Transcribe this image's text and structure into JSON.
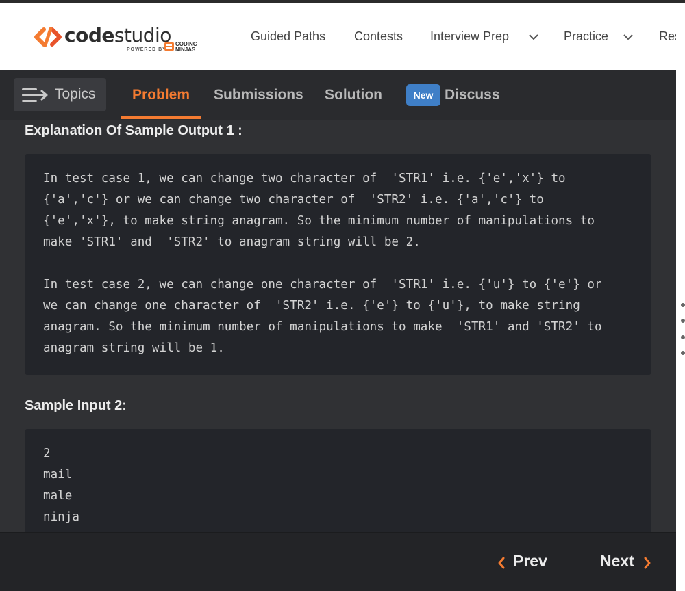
{
  "brand": {
    "name_light": "code",
    "name_regular": "studio",
    "powered_by": "POWERED BY",
    "partner_line1": "CODING",
    "partner_line2": "NINJAS",
    "accent": "#f47b31"
  },
  "nav": {
    "items": [
      {
        "label": "Guided Paths"
      },
      {
        "label": "Contests"
      },
      {
        "label": "Interview Prep",
        "icon": "chevron-down-icon"
      },
      {
        "label": "Practice",
        "icon": "chevron-down-icon"
      },
      {
        "label": "Reso"
      }
    ]
  },
  "tabs": {
    "topics_label": "Topics",
    "items": [
      {
        "label": "Problem",
        "active": true
      },
      {
        "label": "Submissions",
        "active": false
      },
      {
        "label": "Solution",
        "active": false
      },
      {
        "label": "Discuss",
        "active": false,
        "badge": "New"
      }
    ]
  },
  "content": {
    "explanation_heading": "Explanation Of Sample Output 1 :",
    "explanation_lines": [
      "In test case 1, we can change two character of  'STR1' i.e. {'e','x'} to",
      "{'a','c'} or we can change two character of  'STR2' i.e. {'a','c'} to",
      "{'e','x'}, to make string anagram. So the minimum number of manipulations to",
      "make 'STR1' and  'STR2' to anagram string will be 2.",
      "",
      "In test case 2, we can change one character of  'STR1' i.e. {'u'} to {'e'} or",
      "we can change one character of  'STR2' i.e. {'e'} to {'u'}, to make string",
      "anagram. So the minimum number of manipulations to make  'STR1' and 'STR2' to",
      "anagram string will be 1."
    ],
    "sample_input_heading": "Sample Input 2:",
    "sample_input_lines": [
      "2",
      "mail",
      "male",
      "ninja"
    ]
  },
  "footer": {
    "prev_label": "Prev",
    "next_label": "Next"
  },
  "colors": {
    "panel_bg": "#303134",
    "code_bg": "#23252a",
    "badge_bg": "#3f7fc7"
  }
}
